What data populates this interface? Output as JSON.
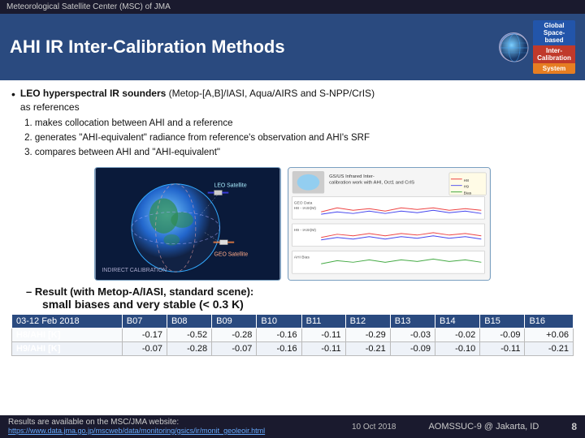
{
  "header": {
    "text": "Meteorological Satellite Center (MSC) of JMA"
  },
  "title": {
    "text": "AHI IR Inter-Calibration Methods"
  },
  "logos": {
    "left_alt": "JMA globe logo",
    "right_alt": "GSICS logo"
  },
  "content": {
    "bullet": "•",
    "main_text_bold": "LEO hyperspectral IR sounders",
    "main_text_rest": " (Metop-[A,B]/IASI, Aqua/AIRS and S-NPP/CrIS)",
    "as_references": "as references",
    "numbered_items": [
      "makes collocation between AHI and a reference",
      "generates \"AHI-equivalent\" radiance from reference's observation and AHI's SRF",
      "compares between AHI and \"AHI-equivalent\""
    ]
  },
  "result": {
    "prefix": "– Result (with Metop-A/IASI, standard scene):",
    "bold_text": "small biases and very stable (< 0.3 K)"
  },
  "table": {
    "headers": [
      "03-12 Feb 2018",
      "B07",
      "B08",
      "B09",
      "B10",
      "B11",
      "B12",
      "B13",
      "B14",
      "B15",
      "B16"
    ],
    "rows": [
      {
        "label": "H8/AHI [K]",
        "values": [
          "-0.17",
          "-0.52",
          "-0.28",
          "-0.16",
          "-0.11",
          "-0.29",
          "-0.03",
          "-0.02",
          "-0.09",
          "+0.06"
        ]
      },
      {
        "label": "H9/AHI [K]",
        "values": [
          "-0.07",
          "-0.28",
          "-0.07",
          "-0.16",
          "-0.11",
          "-0.21",
          "-0.09",
          "-0.10",
          "-0.11",
          "-0.21"
        ]
      }
    ]
  },
  "footer": {
    "website_text": "Results are available on the MSC/JMA website:",
    "website_url": "https://www.data.jma.go.jp/mscweb/data/monitoring/gsics/ir/monit_geoleoir.html",
    "date": "10 Oct 2018",
    "conference": "AOMSSUC-9 @ Jakarta, ID",
    "page_number": "8"
  }
}
